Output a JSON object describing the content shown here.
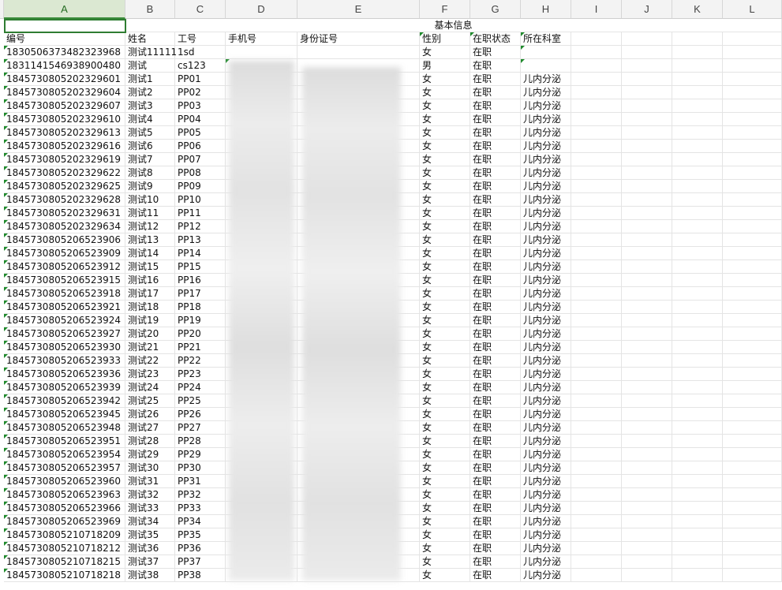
{
  "spreadsheet": {
    "columns": [
      "A",
      "B",
      "C",
      "D",
      "E",
      "F",
      "G",
      "H",
      "I",
      "J",
      "K",
      "L"
    ],
    "active_column": "A",
    "merged_title": "基本信息",
    "headers": [
      "编号",
      "姓名",
      "工号",
      "手机号",
      "身份证号",
      "性别",
      "在职状态",
      "所在科室"
    ],
    "rows": [
      [
        "1830506373482323968",
        "测试11111",
        "1sd",
        "",
        "",
        "女",
        "在职",
        ""
      ],
      [
        "1831141546938900480",
        "测试",
        "cs123",
        "",
        "",
        "男",
        "在职",
        ""
      ],
      [
        "1845730805202329601",
        "测试1",
        "PP01",
        "",
        "",
        "女",
        "在职",
        "儿内分泌"
      ],
      [
        "1845730805202329604",
        "测试2",
        "PP02",
        "",
        "",
        "女",
        "在职",
        "儿内分泌"
      ],
      [
        "1845730805202329607",
        "测试3",
        "PP03",
        "",
        "",
        "女",
        "在职",
        "儿内分泌"
      ],
      [
        "1845730805202329610",
        "测试4",
        "PP04",
        "",
        "",
        "女",
        "在职",
        "儿内分泌"
      ],
      [
        "1845730805202329613",
        "测试5",
        "PP05",
        "",
        "",
        "女",
        "在职",
        "儿内分泌"
      ],
      [
        "1845730805202329616",
        "测试6",
        "PP06",
        "",
        "",
        "女",
        "在职",
        "儿内分泌"
      ],
      [
        "1845730805202329619",
        "测试7",
        "PP07",
        "",
        "",
        "女",
        "在职",
        "儿内分泌"
      ],
      [
        "1845730805202329622",
        "测试8",
        "PP08",
        "",
        "",
        "女",
        "在职",
        "儿内分泌"
      ],
      [
        "1845730805202329625",
        "测试9",
        "PP09",
        "",
        "",
        "女",
        "在职",
        "儿内分泌"
      ],
      [
        "1845730805202329628",
        "测试10",
        "PP10",
        "",
        "",
        "女",
        "在职",
        "儿内分泌"
      ],
      [
        "1845730805202329631",
        "测试11",
        "PP11",
        "",
        "",
        "女",
        "在职",
        "儿内分泌"
      ],
      [
        "1845730805202329634",
        "测试12",
        "PP12",
        "",
        "",
        "女",
        "在职",
        "儿内分泌"
      ],
      [
        "1845730805206523906",
        "测试13",
        "PP13",
        "",
        "",
        "女",
        "在职",
        "儿内分泌"
      ],
      [
        "1845730805206523909",
        "测试14",
        "PP14",
        "",
        "",
        "女",
        "在职",
        "儿内分泌"
      ],
      [
        "1845730805206523912",
        "测试15",
        "PP15",
        "",
        "",
        "女",
        "在职",
        "儿内分泌"
      ],
      [
        "1845730805206523915",
        "测试16",
        "PP16",
        "",
        "",
        "女",
        "在职",
        "儿内分泌"
      ],
      [
        "1845730805206523918",
        "测试17",
        "PP17",
        "",
        "",
        "女",
        "在职",
        "儿内分泌"
      ],
      [
        "1845730805206523921",
        "测试18",
        "PP18",
        "",
        "",
        "女",
        "在职",
        "儿内分泌"
      ],
      [
        "1845730805206523924",
        "测试19",
        "PP19",
        "",
        "",
        "女",
        "在职",
        "儿内分泌"
      ],
      [
        "1845730805206523927",
        "测试20",
        "PP20",
        "",
        "",
        "女",
        "在职",
        "儿内分泌"
      ],
      [
        "1845730805206523930",
        "测试21",
        "PP21",
        "",
        "",
        "女",
        "在职",
        "儿内分泌"
      ],
      [
        "1845730805206523933",
        "测试22",
        "PP22",
        "",
        "",
        "女",
        "在职",
        "儿内分泌"
      ],
      [
        "1845730805206523936",
        "测试23",
        "PP23",
        "",
        "",
        "女",
        "在职",
        "儿内分泌"
      ],
      [
        "1845730805206523939",
        "测试24",
        "PP24",
        "",
        "",
        "女",
        "在职",
        "儿内分泌"
      ],
      [
        "1845730805206523942",
        "测试25",
        "PP25",
        "",
        "",
        "女",
        "在职",
        "儿内分泌"
      ],
      [
        "1845730805206523945",
        "测试26",
        "PP26",
        "",
        "",
        "女",
        "在职",
        "儿内分泌"
      ],
      [
        "1845730805206523948",
        "测试27",
        "PP27",
        "",
        "",
        "女",
        "在职",
        "儿内分泌"
      ],
      [
        "1845730805206523951",
        "测试28",
        "PP28",
        "",
        "",
        "女",
        "在职",
        "儿内分泌"
      ],
      [
        "1845730805206523954",
        "测试29",
        "PP29",
        "",
        "",
        "女",
        "在职",
        "儿内分泌"
      ],
      [
        "1845730805206523957",
        "测试30",
        "PP30",
        "",
        "",
        "女",
        "在职",
        "儿内分泌"
      ],
      [
        "1845730805206523960",
        "测试31",
        "PP31",
        "",
        "",
        "女",
        "在职",
        "儿内分泌"
      ],
      [
        "1845730805206523963",
        "测试32",
        "PP32",
        "",
        "",
        "女",
        "在职",
        "儿内分泌"
      ],
      [
        "1845730805206523966",
        "测试33",
        "PP33",
        "",
        "",
        "女",
        "在职",
        "儿内分泌"
      ],
      [
        "1845730805206523969",
        "测试34",
        "PP34",
        "",
        "",
        "女",
        "在职",
        "儿内分泌"
      ],
      [
        "1845730805210718209",
        "测试35",
        "PP35",
        "",
        "",
        "女",
        "在职",
        "儿内分泌"
      ],
      [
        "1845730805210718212",
        "测试36",
        "PP36",
        "",
        "",
        "女",
        "在职",
        "儿内分泌"
      ],
      [
        "1845730805210718215",
        "测试37",
        "PP37",
        "",
        "",
        "女",
        "在职",
        "儿内分泌"
      ],
      [
        "1845730805210718218",
        "测试38",
        "PP38",
        "",
        "",
        "女",
        "在职",
        "儿内分泌"
      ]
    ]
  }
}
